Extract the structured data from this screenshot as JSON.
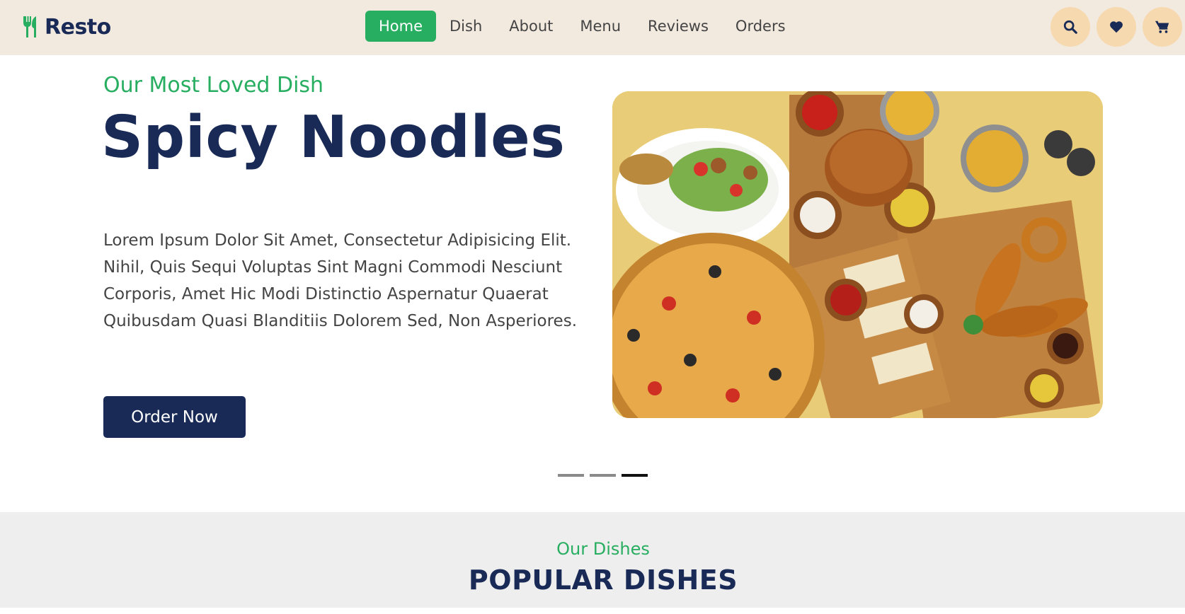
{
  "brand": {
    "name": "Resto",
    "icon": "fork-spoon-icon",
    "accent": "#27ae60",
    "navy": "#192a56"
  },
  "nav": {
    "items": [
      {
        "label": "Home",
        "active": true
      },
      {
        "label": "Dish",
        "active": false
      },
      {
        "label": "About",
        "active": false
      },
      {
        "label": "Menu",
        "active": false
      },
      {
        "label": "Reviews",
        "active": false
      },
      {
        "label": "Orders",
        "active": false
      }
    ]
  },
  "header_icons": [
    "search-icon",
    "heart-icon",
    "cart-icon"
  ],
  "hero": {
    "subtitle": "Our Most Loved Dish",
    "title": "Spicy Noodles",
    "description": "Lorem Ipsum Dolor Sit Amet, Consectetur Adipisicing Elit. Nihil, Quis Sequi Voluptas Sint Magni Commodi Nesciunt Corporis, Amet Hic Modi Distinctio Aspernatur Quaerat Quibusdam Quasi Blanditiis Dolorem Sed, Non Asperiores.",
    "button": "Order Now",
    "image": "food-platter-image"
  },
  "slider": {
    "count": 3,
    "active_index": 2
  },
  "section": {
    "subtitle": "Our Dishes",
    "title": "POPULAR DISHES"
  }
}
